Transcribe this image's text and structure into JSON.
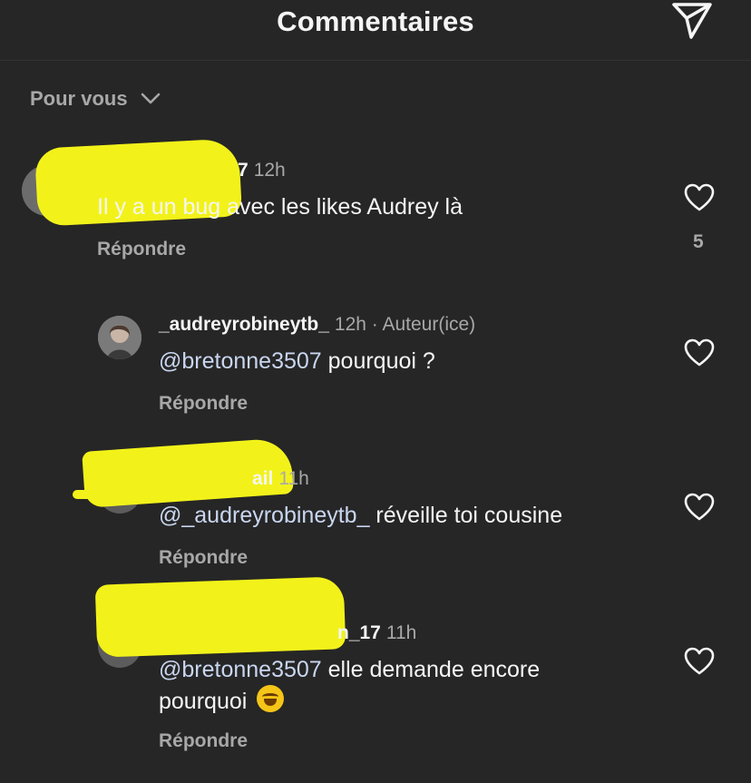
{
  "header": {
    "title": "Commentaires",
    "send_icon": "paper-plane-icon"
  },
  "sort": {
    "label": "Pour vous",
    "icon": "chevron-down-icon"
  },
  "comments": [
    {
      "username_suffix": "7",
      "time": "12h",
      "text": "Il y a un bug avec les likes Audrey là",
      "reply_label": "Répondre",
      "likes": "5"
    },
    {
      "username": "_audreyrobineytb_",
      "time": "12h",
      "author_badge": "· Auteur(ice)",
      "mention": "@bretonne3507",
      "text": " pourquoi ?",
      "reply_label": "Répondre"
    },
    {
      "username_suffix": "ail",
      "time": "11h",
      "mention": "@_audreyrobineytb_",
      "text": " réveille toi cousine",
      "reply_label": "Répondre"
    },
    {
      "username_suffix": "n_17",
      "time": "11h",
      "mention": "@bretonne3507",
      "text": " elle demande encore",
      "text_line2": "pourquoi",
      "emoji": "rolling-on-floor-laughing-emoji",
      "reply_label": "Répondre"
    }
  ],
  "colors": {
    "background": "#262626",
    "scribble": "#f2f21a",
    "mention": "#c9d6f0",
    "secondary": "#a8a8a8"
  }
}
